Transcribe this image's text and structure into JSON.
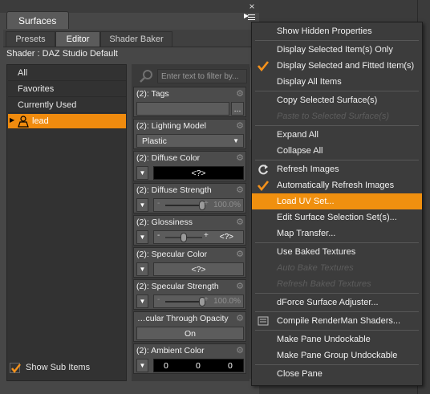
{
  "pane": {
    "title": "Surfaces",
    "close_glyph": "×",
    "tabs": [
      {
        "label": "Presets",
        "active": false
      },
      {
        "label": "Editor",
        "active": true
      },
      {
        "label": "Shader Baker",
        "active": false
      }
    ],
    "shader_label": "Shader : DAZ Studio Default"
  },
  "categories": [
    {
      "label": "All",
      "selected": false
    },
    {
      "label": "Favorites",
      "selected": false
    },
    {
      "label": "Currently Used",
      "selected": false
    },
    {
      "label": "lead",
      "selected": true,
      "icon": "figure-icon"
    }
  ],
  "show_sub_items": {
    "label": "Show Sub Items",
    "checked": true
  },
  "filter": {
    "placeholder": "Enter text to filter by..."
  },
  "properties": [
    {
      "label": "(2): Tags",
      "control": "text",
      "value": "",
      "button": "..."
    },
    {
      "label": "(2): Lighting Model",
      "control": "select",
      "value": "Plastic"
    },
    {
      "label": "(2): Diffuse Color",
      "control": "color",
      "value": "<?>"
    },
    {
      "label": "(2): Diffuse Strength",
      "control": "slider",
      "value": "100.0%",
      "level": 1.0
    },
    {
      "label": "(2): Glossiness",
      "control": "slider-mixed",
      "value": "<?>",
      "level": 0.5
    },
    {
      "label": "(2): Specular Color",
      "control": "color-grey",
      "value": "<?>"
    },
    {
      "label": "(2): Specular Strength",
      "control": "slider",
      "value": "100.0%",
      "level": 1.0
    },
    {
      "label": "…cular Through Opacity",
      "control": "toggle",
      "value": "On"
    },
    {
      "label": "(2): Ambient Color",
      "control": "rgb",
      "values": [
        "0",
        "0",
        "0"
      ]
    }
  ],
  "menu": {
    "items": [
      {
        "label": "Show Hidden Properties",
        "enabled": true
      },
      {
        "sep": true
      },
      {
        "label": "Display Selected Item(s) Only",
        "enabled": true
      },
      {
        "label": "Display Selected and Fitted Item(s)",
        "enabled": true,
        "checked": true
      },
      {
        "label": "Display All Items",
        "enabled": true
      },
      {
        "sep": true
      },
      {
        "label": "Copy Selected Surface(s)",
        "enabled": true
      },
      {
        "label": "Paste to Selected Surface(s)",
        "enabled": false
      },
      {
        "sep": true
      },
      {
        "label": "Expand All",
        "enabled": true
      },
      {
        "label": "Collapse All",
        "enabled": true
      },
      {
        "sep": true
      },
      {
        "label": "Refresh Images",
        "enabled": true,
        "icon": "refresh-icon"
      },
      {
        "label": "Automatically Refresh Images",
        "enabled": true,
        "checked": true
      },
      {
        "label": "Load UV Set...",
        "enabled": true,
        "highlighted": true
      },
      {
        "label": "Edit Surface Selection Set(s)...",
        "enabled": true
      },
      {
        "label": "Map Transfer...",
        "enabled": true
      },
      {
        "sep": true
      },
      {
        "label": "Use Baked Textures",
        "enabled": true
      },
      {
        "label": "Auto Bake Textures",
        "enabled": false
      },
      {
        "label": "Refresh Baked Textures",
        "enabled": false
      },
      {
        "sep": true
      },
      {
        "label": "dForce Surface Adjuster...",
        "enabled": true
      },
      {
        "sep": true
      },
      {
        "label": "Compile RenderMan Shaders...",
        "enabled": true,
        "icon": "renderman-icon"
      },
      {
        "sep": true
      },
      {
        "label": "Make Pane Undockable",
        "enabled": true
      },
      {
        "label": "Make Pane Group Undockable",
        "enabled": true
      },
      {
        "sep": true
      },
      {
        "label": "Close Pane",
        "enabled": true
      }
    ]
  },
  "colors": {
    "accent": "#f08b0e",
    "menu_bg": "#3c3c3c",
    "pane_bg": "#474747"
  }
}
